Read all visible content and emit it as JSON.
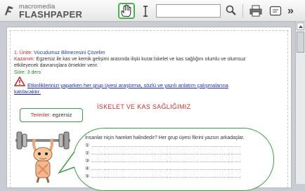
{
  "app": {
    "logo_top": "macromedia",
    "logo_bottom": "FLASHPAPER"
  },
  "toolbar": {
    "search_placeholder": "",
    "more_label": "»",
    "icons": [
      "hand-tool-icon",
      "text-select-icon",
      "search-icon",
      "print-icon",
      "view-icon",
      "more-icon"
    ]
  },
  "document": {
    "unit_label": "1. Ünite:",
    "unit_value": "Vücudumuz Bilmecesini Çözelim",
    "kazanim_label": "Kazanım:",
    "kazanim_line1": "Egzersiz ile kas ve kemik gelişimi arasında ilişki kurar.İskelet ve kas sağlığını olumlu ve olumsuz",
    "kazanim_line2": "etkileyecek davranışlara örnekler verir.",
    "sure_label": "Süre:",
    "sure_value": "3 ders",
    "warning_line1": "Etkinliklerinizi yaparken her grup üyesi araştırma, sözlü ve yazılı anlatım çalışmalarına",
    "warning_line2": "katılacaktır.",
    "title": "İSKELET VE KAS SAĞLIĞIMIZ",
    "terms_label": "Terimler:",
    "terms_value": "egzersiz",
    "question": "İnsanlar niçin hareket halindedir? Her grup üyesi fikrini yazsın arkadaşlar.",
    "answer_lines": [
      "①",
      "②",
      "③",
      "④",
      "⑤"
    ],
    "dots": "......................................................................................."
  },
  "colors": {
    "accent_green": "#3f9d46",
    "title_red": "#d32f2f",
    "link_blue": "#1d2fa8"
  }
}
